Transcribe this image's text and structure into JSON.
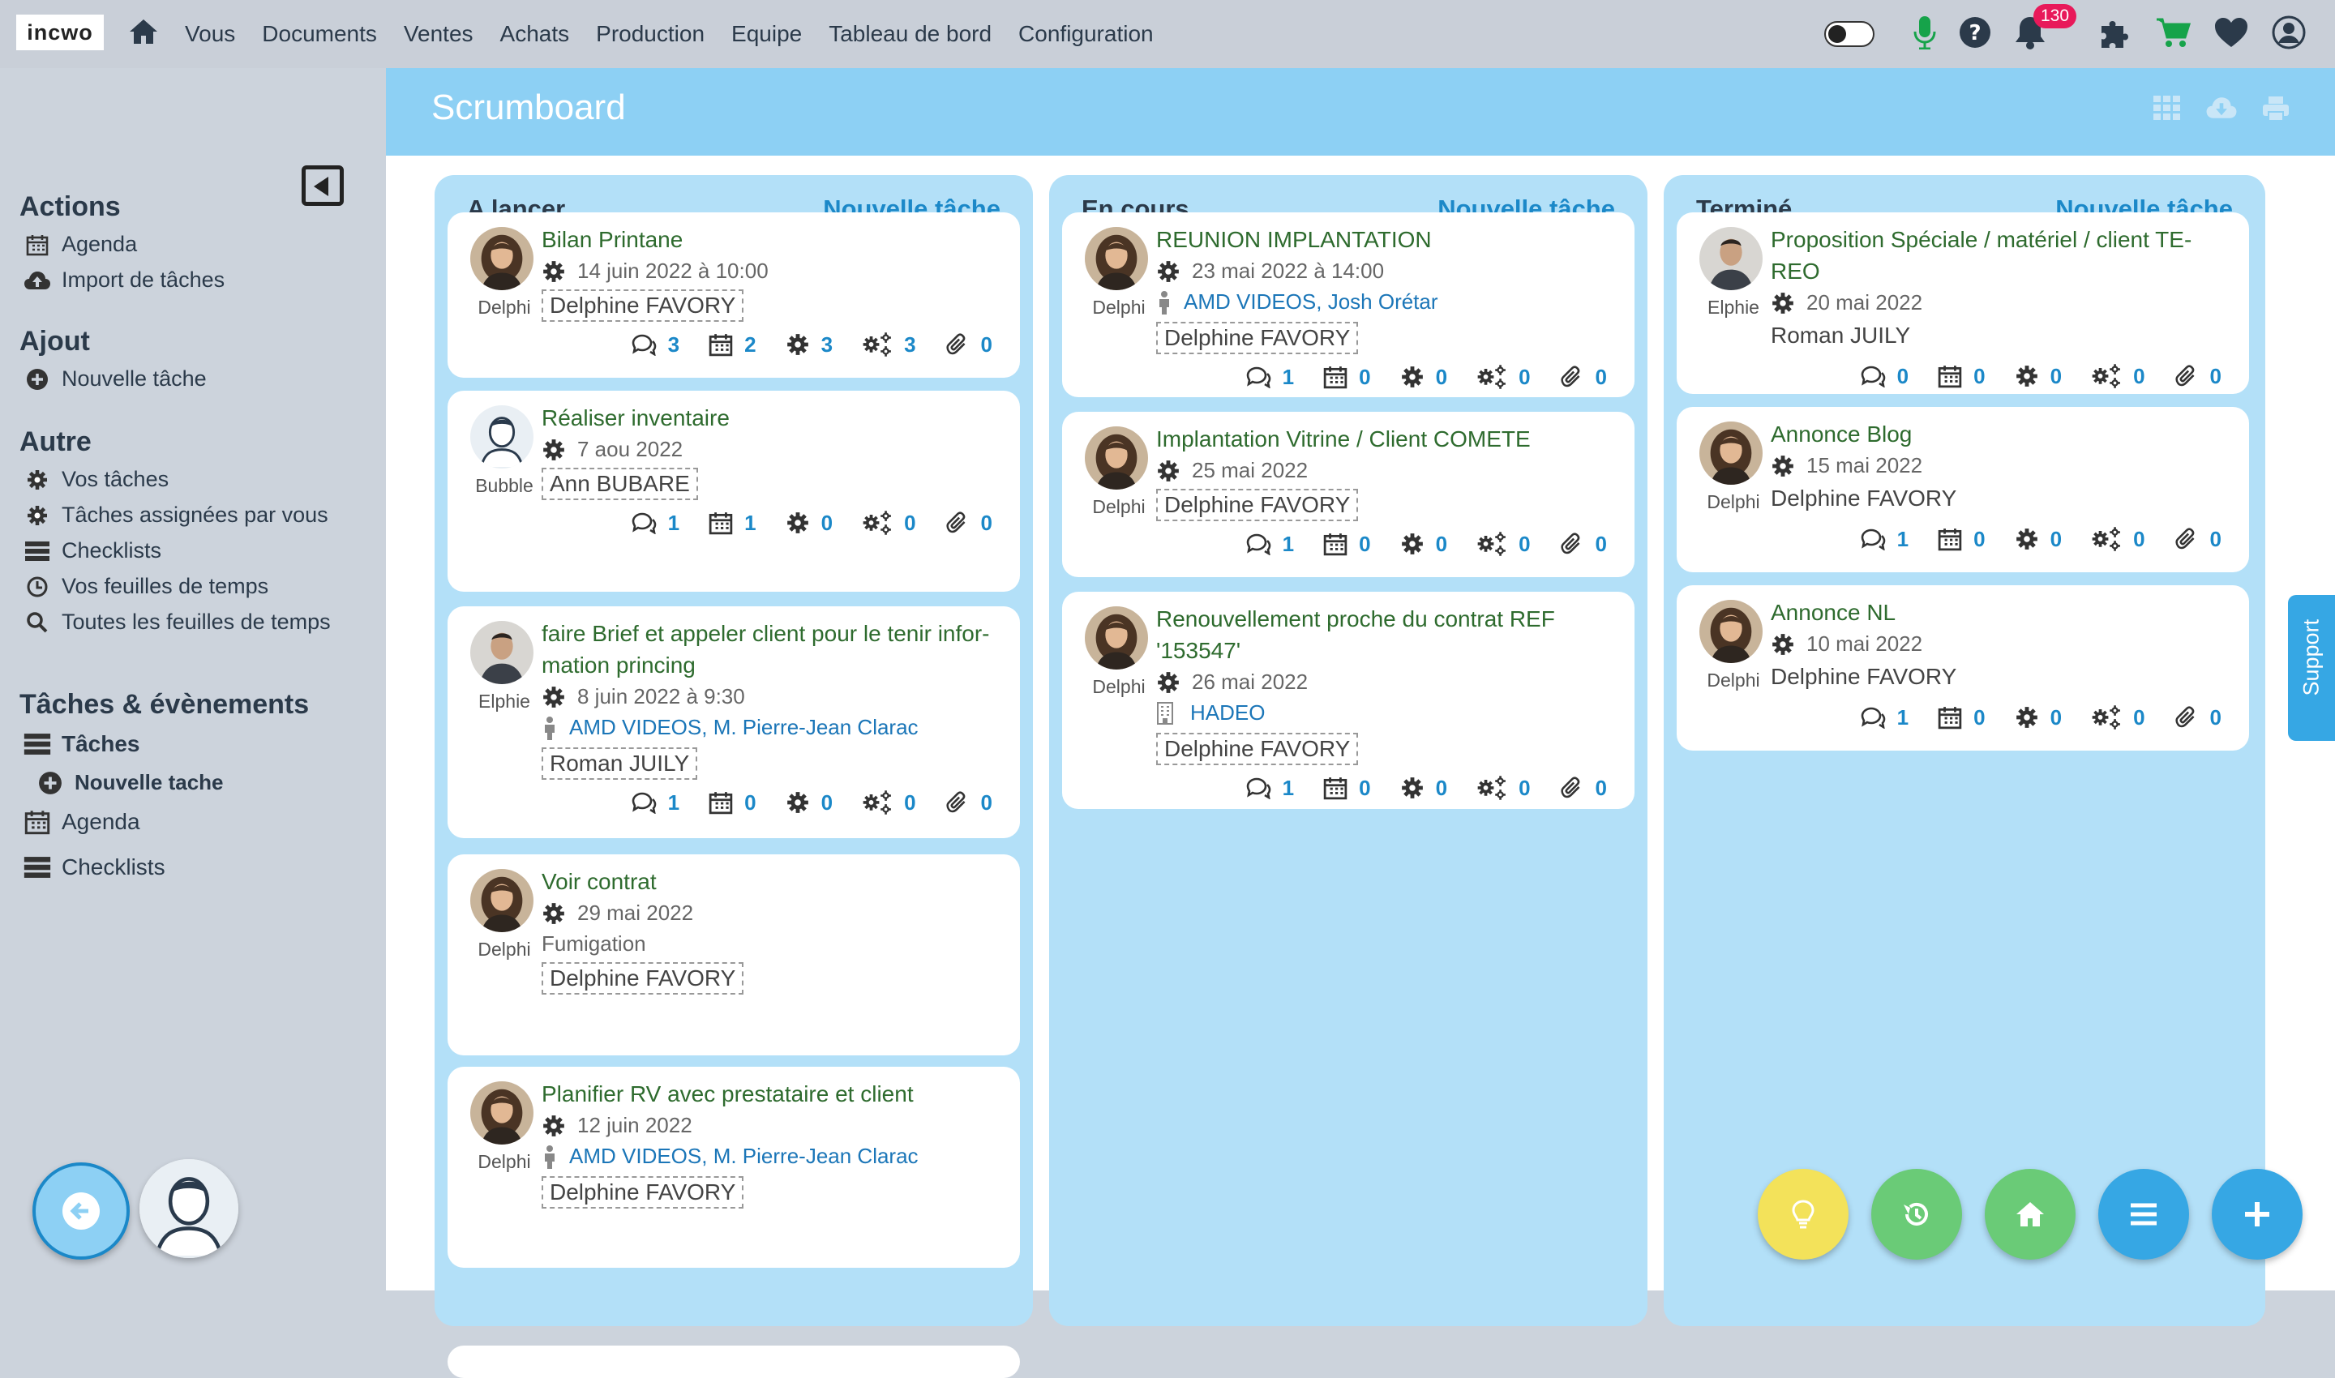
{
  "app": {
    "logo": "incwo"
  },
  "nav": {
    "items": [
      "Vous",
      "Documents",
      "Ventes",
      "Achats",
      "Production",
      "Equipe",
      "Tableau de bord",
      "Configuration"
    ]
  },
  "top": {
    "notification_count": "130"
  },
  "sidebar": {
    "actions_title": "Actions",
    "actions": [
      "Agenda",
      "Import de tâches"
    ],
    "ajout_title": "Ajout",
    "ajout": [
      "Nouvelle tâche"
    ],
    "autre_title": "Autre",
    "autre": [
      "Vos tâches",
      "Tâches assignées par vous",
      "Checklists",
      "Vos feuilles de temps",
      "Toutes les feuilles de temps"
    ],
    "events_title": "Tâches & évènements",
    "events": [
      "Tâches",
      "Nouvelle tache",
      "Agenda",
      "Checklists"
    ]
  },
  "page": {
    "title": "Scrumboard"
  },
  "columns": [
    {
      "title": "A lancer",
      "new_label": "Nouvelle tâche",
      "cards": [
        {
          "title": "Bilan Printane",
          "user": "Delphi",
          "date": "14 juin 2022 à 10:00",
          "assignee": "Delphine FAVORY",
          "stats": [
            "3",
            "2",
            "3",
            "3",
            "0"
          ]
        },
        {
          "title": "Réaliser inventaire",
          "user": "Bubble",
          "date": "7 aou 2022",
          "assignee": "Ann BUBARE",
          "stats": [
            "1",
            "1",
            "0",
            "0",
            "0"
          ]
        },
        {
          "title": "faire Brief et appeler client pour le tenir infor-",
          "title2": "mation princing",
          "user": "Elphie",
          "date": "8 juin 2022 à 9:30",
          "contact": "AMD VIDEOS, M. Pierre-Jean Clarac",
          "assignee": "Roman JUILY",
          "stats": [
            "1",
            "0",
            "0",
            "0",
            "0"
          ]
        },
        {
          "title": "Voir contrat",
          "user": "Delphi",
          "date": "29 mai 2022",
          "extra": "Fumigation",
          "assignee": "Delphine FAVORY"
        },
        {
          "title": "Planifier RV avec prestataire et client",
          "user": "Delphi",
          "date": "12 juin 2022",
          "contact": "AMD VIDEOS, M. Pierre-Jean Clarac",
          "assignee": "Delphine FAVORY"
        }
      ]
    },
    {
      "title": "En cours",
      "new_label": "Nouvelle tâche",
      "cards": [
        {
          "title": "REUNION IMPLANTATION",
          "user": "Delphi",
          "date": "23 mai 2022 à 14:00",
          "contact": "AMD VIDEOS, Josh Orétar",
          "assignee": "Delphine FAVORY",
          "stats": [
            "1",
            "0",
            "0",
            "0",
            "0"
          ]
        },
        {
          "title": "Implantation Vitrine / Client COMETE",
          "user": "Delphi",
          "date": "25 mai 2022",
          "assignee": "Delphine FAVORY",
          "stats": [
            "1",
            "0",
            "0",
            "0",
            "0"
          ]
        },
        {
          "title": "Renouvellement proche du contrat REF",
          "title2": "'153547'",
          "user": "Delphi",
          "date": "26 mai 2022",
          "company": "HADEO",
          "assignee": "Delphine FAVORY",
          "stats": [
            "1",
            "0",
            "0",
            "0",
            "0"
          ]
        }
      ]
    },
    {
      "title": "Terminé",
      "new_label": "Nouvelle tâche",
      "cards": [
        {
          "title": "Proposition Spéciale / matériel / client TE-",
          "title2": "REO",
          "user": "Elphie",
          "date": "20 mai 2022",
          "assignee": "Roman JUILY",
          "stats": [
            "0",
            "0",
            "0",
            "0",
            "0"
          ]
        },
        {
          "title": "Annonce Blog",
          "user": "Delphi",
          "date": "15 mai 2022",
          "assignee": "Delphine FAVORY",
          "stats": [
            "1",
            "0",
            "0",
            "0",
            "0"
          ]
        },
        {
          "title": "Annonce NL",
          "user": "Delphi",
          "date": "10 mai 2022",
          "assignee": "Delphine FAVORY",
          "stats": [
            "1",
            "0",
            "0",
            "0",
            "0"
          ]
        }
      ]
    }
  ],
  "support": {
    "label": "Support"
  },
  "colors": {
    "accent": "#1b88c8",
    "header": "#8dd0f4",
    "column": "#b3e0f8",
    "title_green": "#2e6b2e"
  }
}
